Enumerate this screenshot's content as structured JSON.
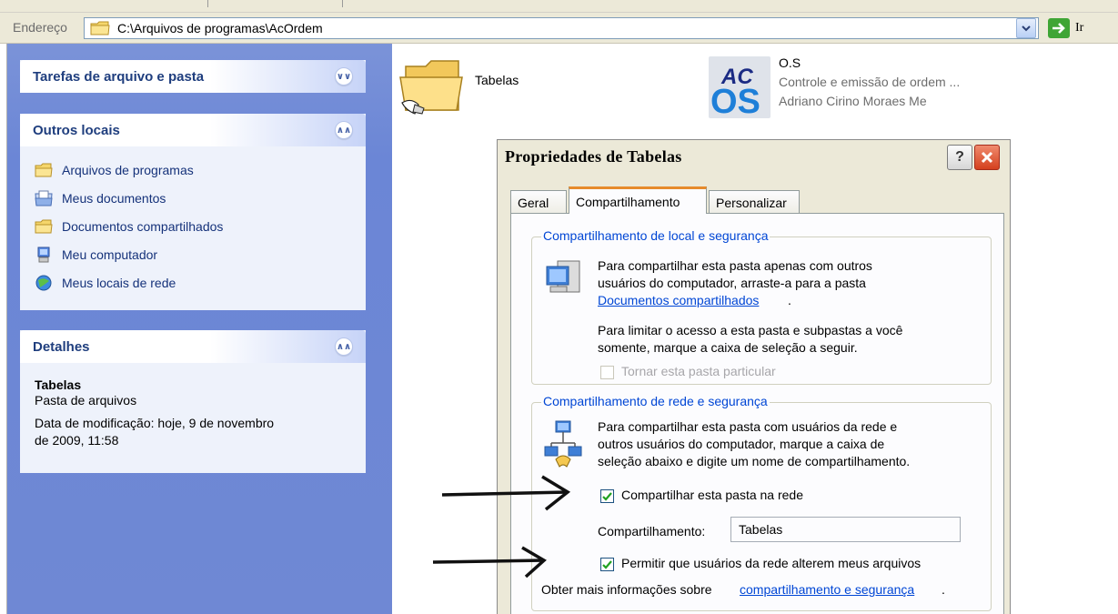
{
  "address": {
    "label": "Endereço",
    "path": "C:\\Arquivos de programas\\AcOrdem",
    "go_label": "Ir"
  },
  "tasks_panel": {
    "file_tasks_title": "Tarefas de arquivo e pasta",
    "other_places_title": "Outros locais",
    "other_places": [
      {
        "label": "Arquivos de programas",
        "icon": "folder-icon"
      },
      {
        "label": "Meus documentos",
        "icon": "my-documents-icon"
      },
      {
        "label": "Documentos compartilhados",
        "icon": "folder-icon"
      },
      {
        "label": "Meu computador",
        "icon": "my-computer-icon"
      },
      {
        "label": "Meus locais de rede",
        "icon": "network-places-icon"
      }
    ],
    "details_title": "Detalhes",
    "details": {
      "name": "Tabelas",
      "type": "Pasta de arquivos",
      "modified_line1": "Data de modificação: hoje, 9 de novembro",
      "modified_line2": "de 2009, 11:58"
    }
  },
  "main": {
    "folder_label": "Tabelas",
    "app": {
      "icon_text_top": "AC",
      "icon_text_bottom": "OS",
      "title": "O.S",
      "subtitle": "Controle e emissão de ordem ...",
      "author": "Adriano Cirino Moraes Me"
    }
  },
  "dialog": {
    "title": "Propriedades de Tabelas",
    "help_label": "?",
    "tabs": [
      "Geral",
      "Compartilhamento",
      "Personalizar"
    ],
    "active_tab": "Compartilhamento",
    "local_group": {
      "title": "Compartilhamento de local e segurança",
      "line1": "Para compartilhar esta pasta apenas com outros",
      "line2": "usuários do computador, arraste-a para a pasta",
      "link": "Documentos compartilhados",
      "link_suffix": ".",
      "limit_line1": "Para limitar o acesso a esta pasta e subpastas a você",
      "limit_line2": "somente, marque a caixa de seleção a seguir.",
      "private_label": "Tornar esta pasta particular",
      "private_checked": false,
      "private_enabled": false
    },
    "network_group": {
      "title": "Compartilhamento de rede e segurança",
      "line1": "Para compartilhar esta pasta com usuários da rede e",
      "line2": "outros usuários do computador, marque a caixa de",
      "line3": "seleção abaixo e digite um nome de compartilhamento.",
      "share_label": "Compartilhar esta pasta na rede",
      "share_checked": true,
      "share_name_label": "Compartilhamento:",
      "share_name_value": "Tabelas",
      "allow_label": "Permitir que usuários da rede alterem meus arquivos",
      "allow_checked": true,
      "more_info_prefix": "Obter mais informações sobre ",
      "more_info_link": "compartilhamento e segurança",
      "more_info_suffix": "."
    }
  },
  "colors": {
    "task_pane_blue": "#6f88d4",
    "link_blue": "#0046d5",
    "active_tab_accent": "#e68b2c",
    "close_red": "#d4401e"
  }
}
